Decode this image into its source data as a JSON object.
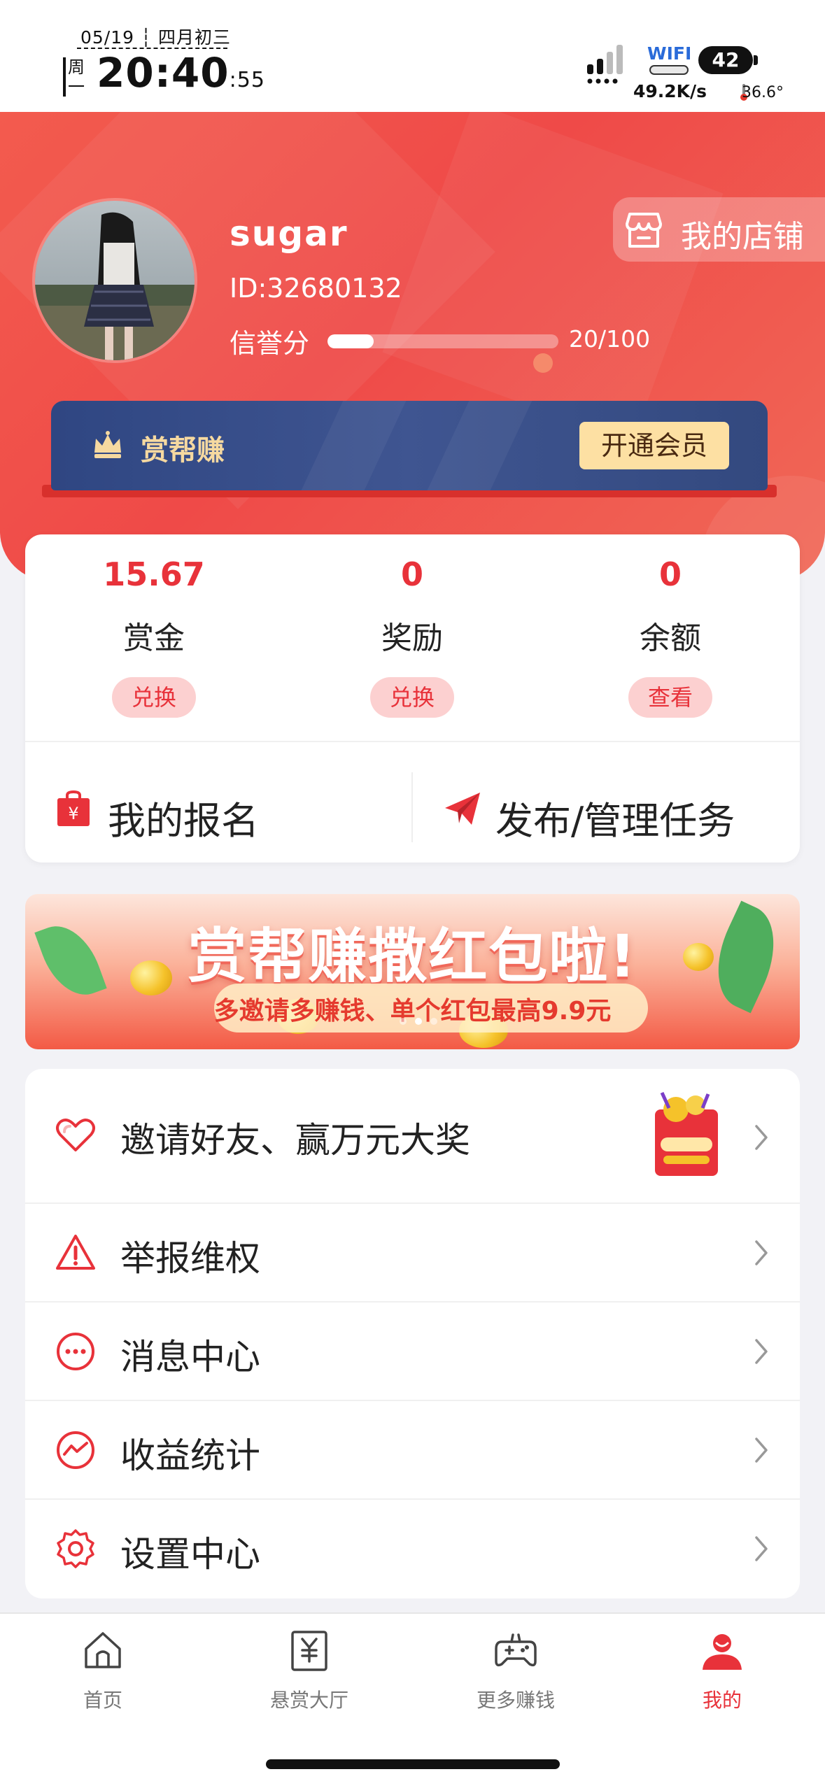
{
  "status_bar": {
    "date": "05/19 ┆ 四月初三",
    "weekday": "周一",
    "time": "20:40",
    "seconds": "55",
    "wifi_label": "WIFI",
    "battery": "42",
    "net_speed": "49.2K/s",
    "temperature": "36.6°"
  },
  "profile": {
    "username": "sugar",
    "user_id": "ID:32680132",
    "credit_label": "信誉分",
    "credit_value": 20,
    "credit_max": 100,
    "credit_text": "20/100",
    "shop_button": "我的店铺"
  },
  "vip": {
    "title": "赏帮赚",
    "button": "开通会员"
  },
  "stats": [
    {
      "value": "15.67",
      "label": "赏金",
      "action": "兑换"
    },
    {
      "value": "0",
      "label": "奖励",
      "action": "兑换"
    },
    {
      "value": "0",
      "label": "余额",
      "action": "查看"
    }
  ],
  "actions": {
    "my_signup": "我的报名",
    "publish_tasks": "发布/管理任务"
  },
  "banner": {
    "title": "赏帮赚撒红包啦!",
    "subtitle": "多邀请多赚钱、单个红包最高9.9元"
  },
  "menu": [
    {
      "label": "邀请好友、赢万元大奖",
      "icon": "heart-icon"
    },
    {
      "label": "举报维权",
      "icon": "warning-icon"
    },
    {
      "label": "消息中心",
      "icon": "message-icon"
    },
    {
      "label": "收益统计",
      "icon": "chart-icon"
    },
    {
      "label": "设置中心",
      "icon": "settings-icon"
    }
  ],
  "tabs": [
    {
      "label": "首页",
      "icon": "home-icon"
    },
    {
      "label": "悬赏大厅",
      "icon": "bounty-icon"
    },
    {
      "label": "更多赚钱",
      "icon": "gamepad-icon"
    },
    {
      "label": "我的",
      "icon": "profile-icon",
      "active": true
    }
  ],
  "colors": {
    "accent": "#e8323a",
    "header": "#ef4a48",
    "vip_bar": "#3f5591",
    "vip_button": "#fde0a3"
  }
}
